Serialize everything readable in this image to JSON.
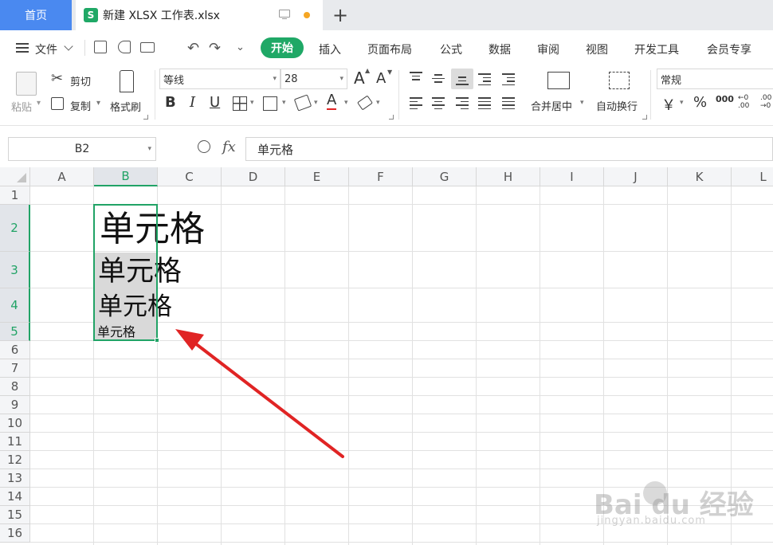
{
  "tabs": {
    "home": "首页",
    "doc_icon": "S",
    "doc_title": "新建 XLSX 工作表.xlsx",
    "new_tab": "+"
  },
  "menu": {
    "file": "文件",
    "items": [
      "开始",
      "插入",
      "页面布局",
      "公式",
      "数据",
      "审阅",
      "视图",
      "开发工具",
      "会员专享"
    ]
  },
  "ribbon": {
    "paste": "粘贴",
    "cut": "剪切",
    "copy": "复制",
    "format_painter": "格式刷",
    "font_name": "等线",
    "font_size": "28",
    "bold": "B",
    "italic": "I",
    "underline": "U",
    "font_color_letter": "A",
    "grow_font": "A",
    "shrink_font": "A",
    "merge_center": "合并居中",
    "wrap_text": "自动换行",
    "number_format": "常规",
    "currency": "￥",
    "percent": "%",
    "thousands": "000",
    "inc_decimal": "←0 .00",
    "dec_decimal": ".00 →0"
  },
  "formula_bar": {
    "name_box": "B2",
    "fx": "fx",
    "value": "单元格"
  },
  "sheet": {
    "columns": [
      "A",
      "B",
      "C",
      "D",
      "E",
      "F",
      "G",
      "H",
      "I",
      "J",
      "K",
      "L"
    ],
    "rows": [
      "1",
      "2",
      "3",
      "4",
      "5",
      "6",
      "7",
      "8",
      "9",
      "10",
      "11",
      "12",
      "13",
      "14",
      "15",
      "16"
    ],
    "cells": {
      "B2": "单元格",
      "B3": "单元格",
      "B4": "单元格",
      "B5": "单元格"
    }
  },
  "watermark": {
    "brand": "Bai du 经验",
    "url": "jingyan.baidu.com"
  },
  "colors": {
    "accent_green": "#1fa866",
    "home_tab_blue": "#4a89f0",
    "arrow_red": "#e02424",
    "selection_green": "#21a366"
  }
}
